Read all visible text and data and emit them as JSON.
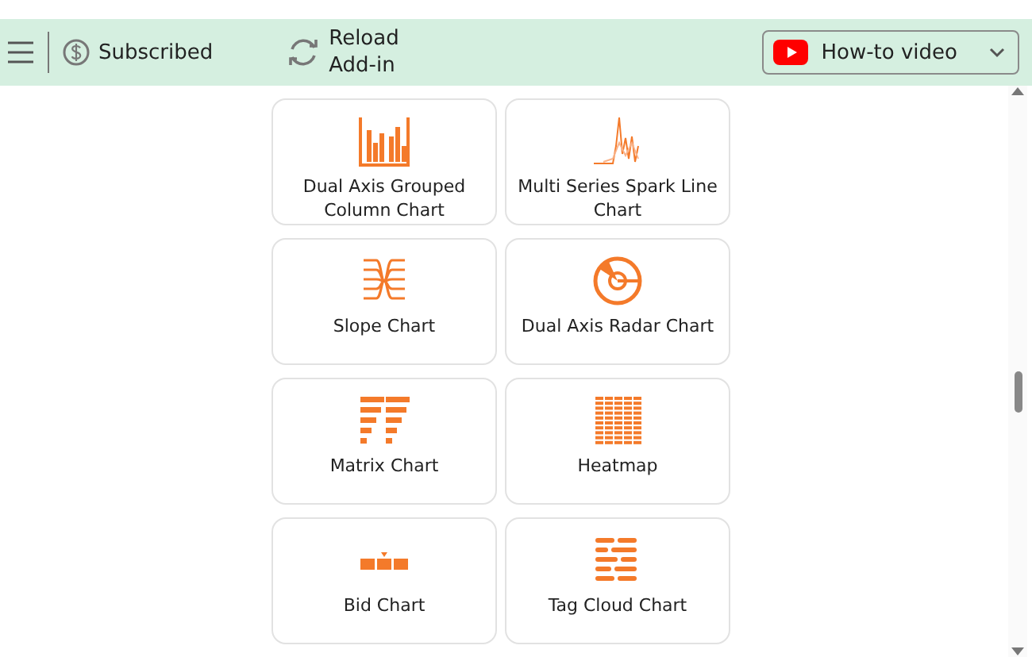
{
  "toolbar": {
    "subscription": "Subscribed",
    "reload": [
      "Reload",
      "Add-in"
    ],
    "video_dropdown": "How-to video"
  },
  "charts": [
    {
      "kind": "grouped-column",
      "label": "Dual Axis Grouped Column Chart"
    },
    {
      "kind": "spark-line",
      "label": "Multi Series Spark Line Chart"
    },
    {
      "kind": "slope",
      "label": "Slope Chart"
    },
    {
      "kind": "radar",
      "label": "Dual Axis Radar Chart"
    },
    {
      "kind": "matrix",
      "label": "Matrix Chart"
    },
    {
      "kind": "heatmap",
      "label": "Heatmap"
    },
    {
      "kind": "bid",
      "label": "Bid Chart"
    },
    {
      "kind": "tag-cloud",
      "label": "Tag Cloud Chart"
    }
  ]
}
